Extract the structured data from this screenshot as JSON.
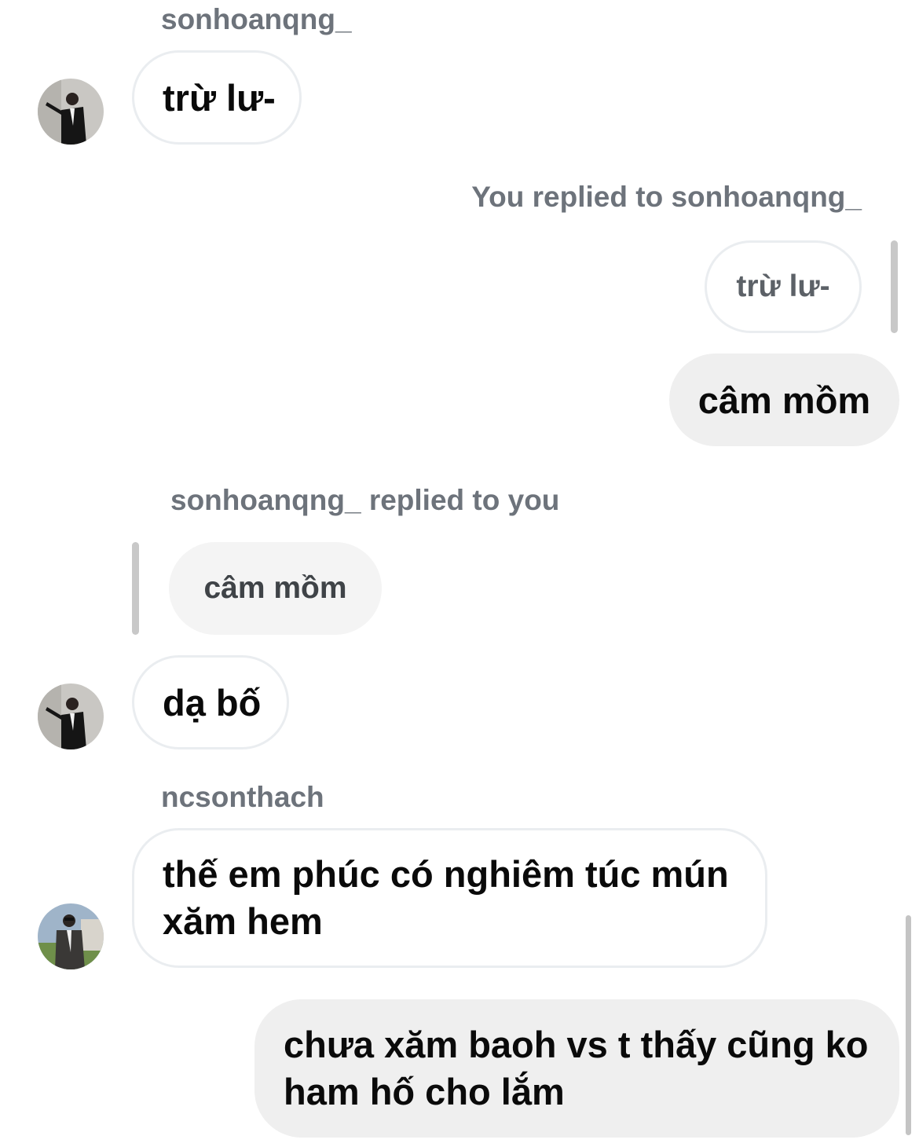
{
  "messages": {
    "m1": {
      "sender": "sonhoanqng_",
      "text": "trừ lư-"
    },
    "m2": {
      "reply_label": "You replied to sonhoanqng_",
      "quoted_text": "trừ lư-",
      "text": "câm mồm"
    },
    "m3": {
      "reply_label": "sonhoanqng_ replied to you",
      "quoted_text": "câm mồm",
      "text": "dạ bố"
    },
    "m4": {
      "sender": "ncsonthach",
      "line1": "thế em phúc có nghiêm túc mún",
      "line2": "xăm hem"
    },
    "m5": {
      "line1": "chưa xăm baoh vs t thấy cũng ko",
      "line2": "ham hố cho lắm"
    }
  },
  "colors": {
    "label_gray": "#6d737b",
    "incoming_border": "#eaedf0",
    "outgoing_bg": "#efefef",
    "quote_bar": "#c8c8c8"
  },
  "icons": [
    "avatar-sonhoanqng",
    "avatar-ncsonthach"
  ]
}
